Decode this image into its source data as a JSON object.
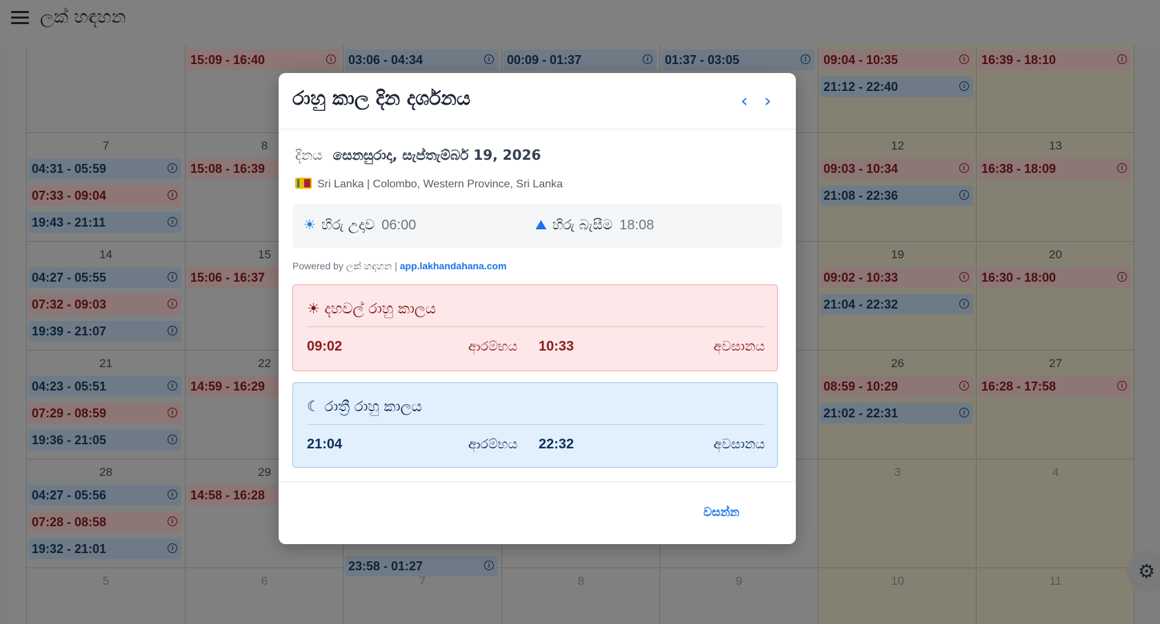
{
  "app": {
    "title": "ලක් හඳහන"
  },
  "calendar": {
    "weeks": [
      {
        "days": [
          {
            "num": "",
            "events": []
          },
          {
            "num": "",
            "events": [
              {
                "time": "15:09 - 16:40",
                "color": "red"
              }
            ]
          },
          {
            "num": "",
            "events": [
              {
                "time": "03:06 - 04:34",
                "color": "blue"
              }
            ]
          },
          {
            "num": "",
            "events": [
              {
                "time": "00:09 - 01:37",
                "color": "blue"
              }
            ]
          },
          {
            "num": "",
            "events": [
              {
                "time": "01:37 - 03:05",
                "color": "blue"
              }
            ]
          },
          {
            "num": "",
            "events": [
              {
                "time": "09:04 - 10:35",
                "color": "red"
              },
              {
                "time": "21:12 - 22:40",
                "color": "blue"
              }
            ]
          },
          {
            "num": "",
            "events": [
              {
                "time": "16:39 - 18:10",
                "color": "red"
              }
            ]
          }
        ]
      },
      {
        "days": [
          {
            "num": "7",
            "events": [
              {
                "time": "04:31 - 05:59",
                "color": "blue"
              },
              {
                "time": "07:33 - 09:04",
                "color": "red"
              },
              {
                "time": "19:43 - 21:11",
                "color": "blue"
              }
            ]
          },
          {
            "num": "8",
            "events": [
              {
                "time": "15:08 - 16:39",
                "color": "red"
              }
            ]
          },
          {
            "num": "",
            "events": []
          },
          {
            "num": "",
            "events": []
          },
          {
            "num": "",
            "events": []
          },
          {
            "num": "12",
            "events": [
              {
                "time": "09:03 - 10:34",
                "color": "red"
              },
              {
                "time": "21:08 - 22:36",
                "color": "blue"
              }
            ]
          },
          {
            "num": "13",
            "events": [
              {
                "time": "16:38 - 18:09",
                "color": "red"
              }
            ]
          }
        ]
      },
      {
        "days": [
          {
            "num": "14",
            "events": [
              {
                "time": "04:27 - 05:55",
                "color": "blue"
              },
              {
                "time": "07:32 - 09:03",
                "color": "red"
              },
              {
                "time": "19:39 - 21:07",
                "color": "blue"
              }
            ]
          },
          {
            "num": "15",
            "events": [
              {
                "time": "15:06 - 16:37",
                "color": "red"
              }
            ]
          },
          {
            "num": "",
            "events": []
          },
          {
            "num": "",
            "events": []
          },
          {
            "num": "",
            "events": []
          },
          {
            "num": "19",
            "events": [
              {
                "time": "09:02 - 10:33",
                "color": "red"
              },
              {
                "time": "21:04 - 22:32",
                "color": "blue"
              }
            ]
          },
          {
            "num": "20",
            "events": [
              {
                "time": "16:30 - 18:00",
                "color": "red"
              }
            ]
          }
        ]
      },
      {
        "days": [
          {
            "num": "21",
            "events": [
              {
                "time": "04:23 - 05:51",
                "color": "blue"
              },
              {
                "time": "07:29 - 08:59",
                "color": "red"
              },
              {
                "time": "19:36 - 21:05",
                "color": "blue"
              }
            ]
          },
          {
            "num": "22",
            "events": [
              {
                "time": "14:59 - 16:29",
                "color": "red"
              }
            ]
          },
          {
            "num": "",
            "events": []
          },
          {
            "num": "",
            "events": []
          },
          {
            "num": "",
            "events": []
          },
          {
            "num": "26",
            "events": [
              {
                "time": "08:59 - 10:29",
                "color": "red"
              },
              {
                "time": "21:02 - 22:31",
                "color": "blue"
              }
            ]
          },
          {
            "num": "27",
            "events": [
              {
                "time": "16:28 - 17:58",
                "color": "red"
              }
            ]
          }
        ]
      },
      {
        "days": [
          {
            "num": "28",
            "events": [
              {
                "time": "04:27 - 05:56",
                "color": "blue"
              },
              {
                "time": "07:28 - 08:58",
                "color": "red"
              },
              {
                "time": "19:32 - 21:01",
                "color": "blue"
              }
            ]
          },
          {
            "num": "29",
            "events": [
              {
                "time": "14:58 - 16:28",
                "color": "red"
              }
            ]
          },
          {
            "num": "",
            "events": [
              {
                "time": "23:58 - 01:27",
                "color": "blue"
              }
            ]
          },
          {
            "num": "",
            "events": []
          },
          {
            "num": "",
            "events": []
          },
          {
            "num": "3",
            "events": []
          },
          {
            "num": "4",
            "events": []
          }
        ]
      },
      {
        "days": [
          {
            "num": "5",
            "events": []
          },
          {
            "num": "6",
            "events": []
          },
          {
            "num": "7",
            "events": []
          },
          {
            "num": "8",
            "events": []
          },
          {
            "num": "9",
            "events": []
          },
          {
            "num": "10",
            "events": []
          },
          {
            "num": "11",
            "events": []
          }
        ]
      }
    ]
  },
  "modal": {
    "title": "රාහු කාල දින දර්ශනය",
    "prev_icon": "chevron-left-icon",
    "next_icon": "chevron-right-icon",
    "date_label": "දිනය",
    "date_value": "සෙනසුරාදා, සැප්තැම්බර් 19, 2026",
    "location": "Sri Lanka | Colombo, Western Province, Sri Lanka",
    "sunrise_label": "හිරු උදාව",
    "sunrise_time": "06:00",
    "sunset_label": "හිරු බැසීම",
    "sunset_time": "18:08",
    "powered_by": "Powered by ලක් හඳහන | ",
    "powered_link": "app.lakhandahana.com",
    "day_card": {
      "title": "දහවල් රාහු කාලය",
      "start": "09:02",
      "start_label": "ආරම්භය",
      "end": "10:33",
      "end_label": "අවසානය"
    },
    "night_card": {
      "title": "රාත්‍රී රාහු කාලය",
      "start": "21:04",
      "start_label": "ආරම්භය",
      "end": "22:32",
      "end_label": "අවසානය"
    },
    "close_label": "වසන්න"
  },
  "colors": {
    "accent": "#1a73e8",
    "day_bg": "#fde7e8",
    "night_bg": "#e2effc"
  }
}
